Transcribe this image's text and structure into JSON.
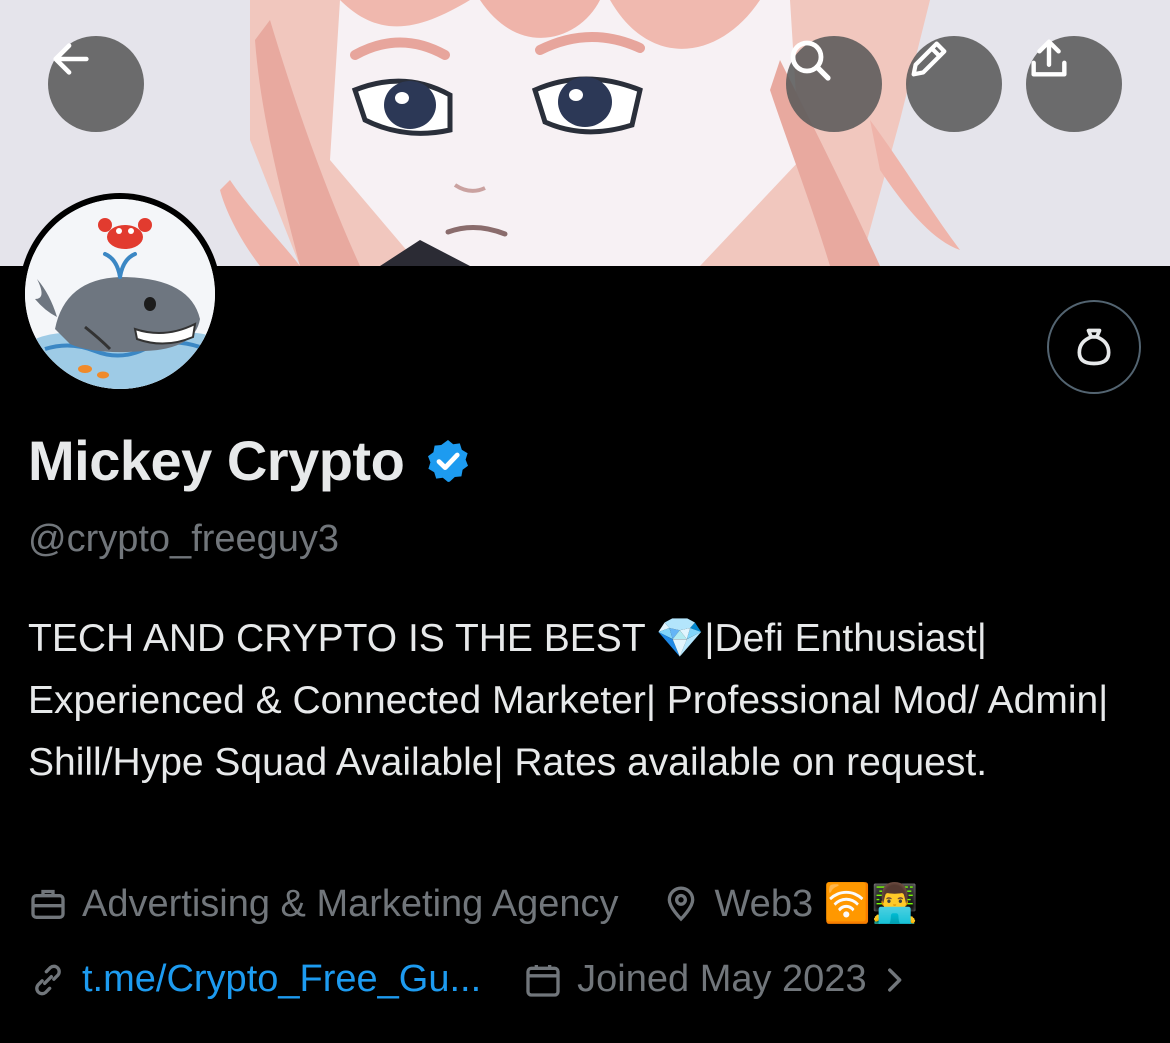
{
  "header": {
    "back_icon": "arrow-left-icon",
    "search_icon": "search-icon",
    "edit_icon": "pencil-icon",
    "share_icon": "share-upload-icon"
  },
  "profile": {
    "display_name": "Mickey Crypto",
    "verified": true,
    "handle": "@crypto_freeguy3",
    "bio": "TECH AND CRYPTO IS THE BEST 💎|Defi Enthusiast| Experienced & Connected Marketer| Professional Mod/ Admin| Shill/Hype Squad Available| Rates available on request.",
    "category": "Advertising & Marketing Agency",
    "location": "Web3 🛜👨‍💻",
    "link": "t.me/Crypto_Free_Gu...",
    "joined": "Joined May 2023",
    "tip_icon": "money-bag-icon"
  },
  "colors": {
    "background": "#000000",
    "primary_text": "#e7e9ea",
    "secondary_text": "#71767b",
    "link": "#1d9bf0",
    "verified": "#1d9bf0"
  }
}
